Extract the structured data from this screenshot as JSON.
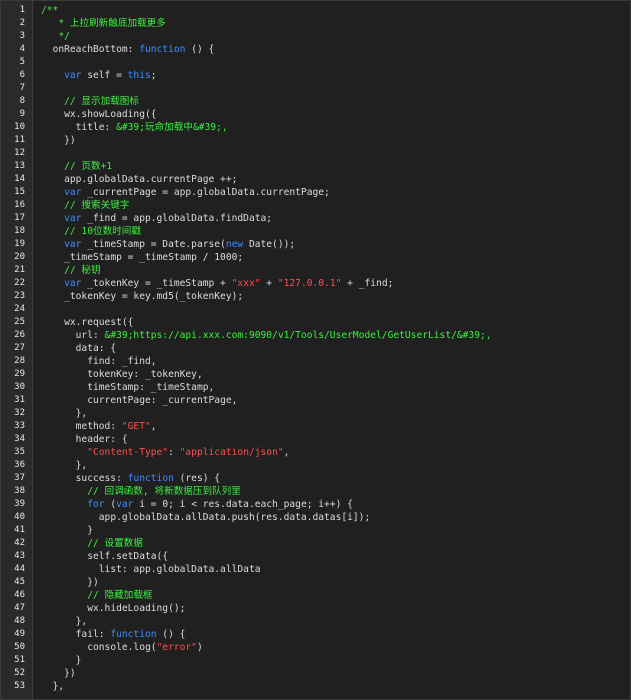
{
  "editor": {
    "lines": [
      {
        "n": "1",
        "indent": "",
        "t": [
          [
            "cm",
            "/**"
          ]
        ]
      },
      {
        "n": "2",
        "indent": "   ",
        "t": [
          [
            "cm",
            "* 上拉刷新触底加载更多"
          ]
        ]
      },
      {
        "n": "3",
        "indent": "   ",
        "t": [
          [
            "cm",
            "*/"
          ]
        ]
      },
      {
        "n": "4",
        "indent": "  ",
        "t": [
          [
            "",
            "onReachBottom: "
          ],
          [
            "kw",
            "function"
          ],
          [
            "",
            " () {"
          ]
        ]
      },
      {
        "n": "5",
        "indent": "",
        "t": []
      },
      {
        "n": "6",
        "indent": "    ",
        "t": [
          [
            "kw",
            "var"
          ],
          [
            "",
            " self = "
          ],
          [
            "kw",
            "this"
          ],
          [
            "",
            ";"
          ]
        ]
      },
      {
        "n": "7",
        "indent": "",
        "t": []
      },
      {
        "n": "8",
        "indent": "    ",
        "t": [
          [
            "cm",
            "// 显示加载图标"
          ]
        ]
      },
      {
        "n": "9",
        "indent": "    ",
        "t": [
          [
            "",
            "wx.showLoading({"
          ]
        ]
      },
      {
        "n": "10",
        "indent": "      ",
        "t": [
          [
            "",
            "title: "
          ],
          [
            "cm",
            "&#39;玩命加载中&#39;,"
          ]
        ]
      },
      {
        "n": "11",
        "indent": "    ",
        "t": [
          [
            "",
            "})"
          ]
        ]
      },
      {
        "n": "12",
        "indent": "",
        "t": []
      },
      {
        "n": "13",
        "indent": "    ",
        "t": [
          [
            "cm",
            "// 页数+1"
          ]
        ]
      },
      {
        "n": "14",
        "indent": "    ",
        "t": [
          [
            "",
            "app.globalData.currentPage ++;"
          ]
        ]
      },
      {
        "n": "15",
        "indent": "    ",
        "t": [
          [
            "kw",
            "var"
          ],
          [
            "",
            " _currentPage = app.globalData.currentPage;"
          ]
        ]
      },
      {
        "n": "16",
        "indent": "    ",
        "t": [
          [
            "cm",
            "// 搜索关键字"
          ]
        ]
      },
      {
        "n": "17",
        "indent": "    ",
        "t": [
          [
            "kw",
            "var"
          ],
          [
            "",
            " _find = app.globalData.findData;"
          ]
        ]
      },
      {
        "n": "18",
        "indent": "    ",
        "t": [
          [
            "cm",
            "// 10位数时间戳"
          ]
        ]
      },
      {
        "n": "19",
        "indent": "    ",
        "t": [
          [
            "kw",
            "var"
          ],
          [
            "",
            " _timeStamp = Date.parse("
          ],
          [
            "kw",
            "new"
          ],
          [
            "",
            " Date());"
          ]
        ]
      },
      {
        "n": "20",
        "indent": "    ",
        "t": [
          [
            "",
            "_timeStamp = _timeStamp / 1000;"
          ]
        ]
      },
      {
        "n": "21",
        "indent": "    ",
        "t": [
          [
            "cm",
            "// 秘钥"
          ]
        ]
      },
      {
        "n": "22",
        "indent": "    ",
        "t": [
          [
            "kw",
            "var"
          ],
          [
            "",
            " _tokenKey = _timeStamp + "
          ],
          [
            "st",
            "\"xxx\""
          ],
          [
            "",
            " + "
          ],
          [
            "st",
            "\"127.0.0.1\""
          ],
          [
            "",
            " + _find;"
          ]
        ]
      },
      {
        "n": "23",
        "indent": "    ",
        "t": [
          [
            "",
            "_tokenKey = key.md5(_tokenKey);"
          ]
        ]
      },
      {
        "n": "24",
        "indent": "",
        "t": []
      },
      {
        "n": "25",
        "indent": "    ",
        "t": [
          [
            "",
            "wx.request({"
          ]
        ]
      },
      {
        "n": "26",
        "indent": "      ",
        "t": [
          [
            "",
            "url: "
          ],
          [
            "cm",
            "&#39;https://api.xxx.com:9090/v1/Tools/UserModel/GetUserList/&#39;,"
          ]
        ]
      },
      {
        "n": "27",
        "indent": "      ",
        "t": [
          [
            "",
            "data: {"
          ]
        ]
      },
      {
        "n": "28",
        "indent": "        ",
        "t": [
          [
            "",
            "find: _find,"
          ]
        ]
      },
      {
        "n": "29",
        "indent": "        ",
        "t": [
          [
            "",
            "tokenKey: _tokenKey,"
          ]
        ]
      },
      {
        "n": "30",
        "indent": "        ",
        "t": [
          [
            "",
            "timeStamp: _timeStamp,"
          ]
        ]
      },
      {
        "n": "31",
        "indent": "        ",
        "t": [
          [
            "",
            "currentPage: _currentPage,"
          ]
        ]
      },
      {
        "n": "32",
        "indent": "      ",
        "t": [
          [
            "",
            "},"
          ]
        ]
      },
      {
        "n": "33",
        "indent": "      ",
        "t": [
          [
            "",
            "method: "
          ],
          [
            "st",
            "\"GET\""
          ],
          [
            "",
            ","
          ]
        ]
      },
      {
        "n": "34",
        "indent": "      ",
        "t": [
          [
            "",
            "header: {"
          ]
        ]
      },
      {
        "n": "35",
        "indent": "        ",
        "t": [
          [
            "st",
            "\"Content-Type\""
          ],
          [
            "",
            ": "
          ],
          [
            "st",
            "\"application/json\""
          ],
          [
            "",
            ","
          ]
        ]
      },
      {
        "n": "36",
        "indent": "      ",
        "t": [
          [
            "",
            "},"
          ]
        ]
      },
      {
        "n": "37",
        "indent": "      ",
        "t": [
          [
            "",
            "success: "
          ],
          [
            "kw",
            "function"
          ],
          [
            "",
            " (res) {"
          ]
        ]
      },
      {
        "n": "38",
        "indent": "        ",
        "t": [
          [
            "cm",
            "// 回调函数, 将新数据压到队列里"
          ]
        ]
      },
      {
        "n": "39",
        "indent": "        ",
        "t": [
          [
            "kw",
            "for"
          ],
          [
            "",
            " ("
          ],
          [
            "kw",
            "var"
          ],
          [
            "",
            " i = 0; i < res.data.each_page; i++) {"
          ]
        ]
      },
      {
        "n": "40",
        "indent": "          ",
        "t": [
          [
            "",
            "app.globalData.allData.push(res.data.datas[i]);"
          ]
        ]
      },
      {
        "n": "41",
        "indent": "        ",
        "t": [
          [
            "",
            "}"
          ]
        ]
      },
      {
        "n": "42",
        "indent": "        ",
        "t": [
          [
            "cm",
            "// 设置数据"
          ]
        ]
      },
      {
        "n": "43",
        "indent": "        ",
        "t": [
          [
            "",
            "self.setData({"
          ]
        ]
      },
      {
        "n": "44",
        "indent": "          ",
        "t": [
          [
            "",
            "list: app.globalData.allData"
          ]
        ]
      },
      {
        "n": "45",
        "indent": "        ",
        "t": [
          [
            "",
            "})"
          ]
        ]
      },
      {
        "n": "46",
        "indent": "        ",
        "t": [
          [
            "cm",
            "// 隐藏加载框"
          ]
        ]
      },
      {
        "n": "47",
        "indent": "        ",
        "t": [
          [
            "",
            "wx.hideLoading();"
          ]
        ]
      },
      {
        "n": "48",
        "indent": "      ",
        "t": [
          [
            "",
            "},"
          ]
        ]
      },
      {
        "n": "49",
        "indent": "      ",
        "t": [
          [
            "",
            "fail: "
          ],
          [
            "kw",
            "function"
          ],
          [
            "",
            " () {"
          ]
        ]
      },
      {
        "n": "50",
        "indent": "        ",
        "t": [
          [
            "",
            "console.log("
          ],
          [
            "st",
            "\"error\""
          ],
          [
            "",
            ")"
          ]
        ]
      },
      {
        "n": "51",
        "indent": "      ",
        "t": [
          [
            "",
            "}"
          ]
        ]
      },
      {
        "n": "52",
        "indent": "    ",
        "t": [
          [
            "",
            "})"
          ]
        ]
      },
      {
        "n": "53",
        "indent": "  ",
        "t": [
          [
            "",
            "},"
          ]
        ]
      }
    ]
  },
  "colors": {
    "background": "#202020",
    "gutter": "#2a2a2a",
    "keyword": "#3f8cff",
    "comment": "#3cf040",
    "string": "#ff4d4d",
    "text": "#dcdcdc"
  }
}
